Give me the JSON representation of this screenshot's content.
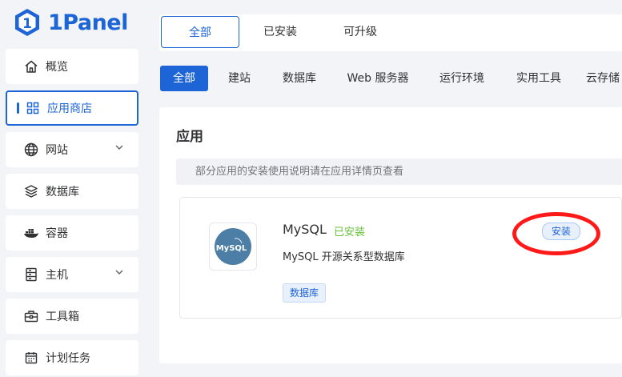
{
  "brand": {
    "name": "1Panel",
    "color": "#1d64d6"
  },
  "sidebar": {
    "items": [
      {
        "label": "概览",
        "icon": "home-icon"
      },
      {
        "label": "应用商店",
        "icon": "apps-grid-icon",
        "active": true
      },
      {
        "label": "网站",
        "icon": "globe-icon",
        "expandable": true
      },
      {
        "label": "数据库",
        "icon": "layers-icon"
      },
      {
        "label": "容器",
        "icon": "docker-icon"
      },
      {
        "label": "主机",
        "icon": "server-icon",
        "expandable": true
      },
      {
        "label": "工具箱",
        "icon": "toolbox-icon"
      },
      {
        "label": "计划任务",
        "icon": "calendar-icon"
      }
    ]
  },
  "top_tabs": [
    {
      "label": "全部",
      "active": true
    },
    {
      "label": "已安装"
    },
    {
      "label": "可升级"
    }
  ],
  "categories": [
    {
      "label": "全部",
      "active": true
    },
    {
      "label": "建站"
    },
    {
      "label": "数据库"
    },
    {
      "label": "Web 服务器"
    },
    {
      "label": "运行环境"
    },
    {
      "label": "实用工具"
    },
    {
      "label": "云存储"
    }
  ],
  "main": {
    "title": "应用",
    "notice": "部分应用的安装使用说明请在应用详情页查看",
    "apps": [
      {
        "name": "MySQL",
        "status": "已安装",
        "description": "MySQL 开源关系型数据库",
        "tag": "数据库",
        "install_label": "安装",
        "icon_text": "MySQL"
      }
    ]
  },
  "colors": {
    "accent": "#1d64d6",
    "installed": "#67c23a",
    "highlight": "#ff1a1a"
  }
}
